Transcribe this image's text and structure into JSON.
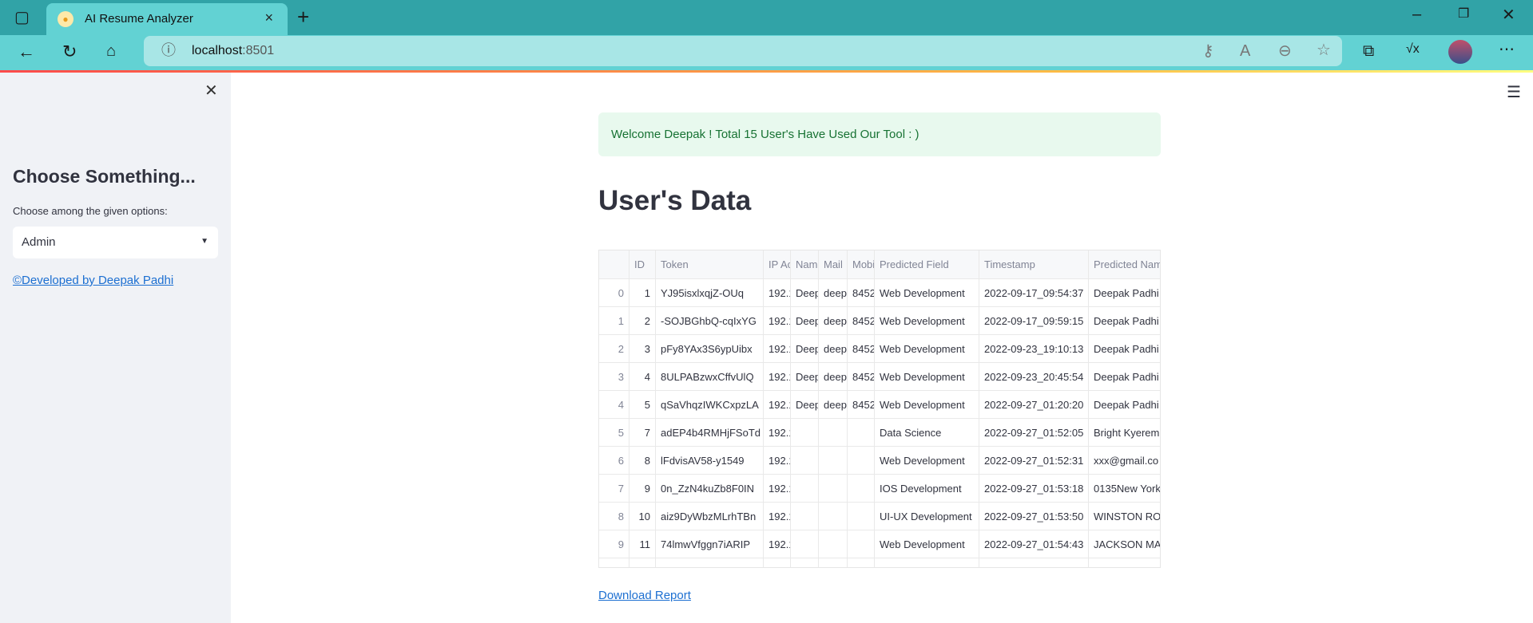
{
  "browser": {
    "tab_title": "AI Resume Analyzer",
    "url_host": "localhost",
    "url_port": ":8501"
  },
  "sidebar": {
    "heading": "Choose Something...",
    "select_label": "Choose among the given options:",
    "select_value": "Admin",
    "credit_link": "©Developed by Deepak Padhi"
  },
  "main": {
    "welcome": "Welcome Deepak ! Total 15 User's Have Used Our Tool : )",
    "title": "User's Data",
    "download_link": "Download Report",
    "table": {
      "columns": [
        "",
        "ID",
        "Token",
        "IP Ac",
        "Nam",
        "Mail",
        "Mobi",
        "Predicted Field",
        "Timestamp",
        "Predicted Nam"
      ],
      "rows": [
        [
          "0",
          "1",
          "YJ95isxlxqjZ-OUq",
          "192.1",
          "Deep",
          "deep",
          "8452",
          "Web Development",
          "2022-09-17_09:54:37",
          "Deepak Padhi"
        ],
        [
          "1",
          "2",
          "-SOJBGhbQ-cqIxYG",
          "192.1",
          "Deep",
          "deep",
          "8452",
          "Web Development",
          "2022-09-17_09:59:15",
          "Deepak Padhi"
        ],
        [
          "2",
          "3",
          "pFy8YAx3S6ypUibx",
          "192.1",
          "Deep",
          "deep",
          "8452",
          "Web Development",
          "2022-09-23_19:10:13",
          "Deepak Padhi"
        ],
        [
          "3",
          "4",
          "8ULPABzwxCffvUlQ",
          "192.1",
          "Deep",
          "deep",
          "8452",
          "Web Development",
          "2022-09-23_20:45:54",
          "Deepak Padhi"
        ],
        [
          "4",
          "5",
          "qSaVhqzIWKCxpzLA",
          "192.1",
          "Deep",
          "deep",
          "8452",
          "Web Development",
          "2022-09-27_01:20:20",
          "Deepak Padhi"
        ],
        [
          "5",
          "7",
          "adEP4b4RMHjFSoTd",
          "192.1",
          "",
          "",
          "",
          "Data Science",
          "2022-09-27_01:52:05",
          "Bright Kyerem"
        ],
        [
          "6",
          "8",
          "lFdvisAV58-y1549",
          "192.1",
          "",
          "",
          "",
          "Web Development",
          "2022-09-27_01:52:31",
          "xxx@gmail.co"
        ],
        [
          "7",
          "9",
          "0n_ZzN4kuZb8F0IN",
          "192.1",
          "",
          "",
          "",
          "IOS Development",
          "2022-09-27_01:53:18",
          "0135New York"
        ],
        [
          "8",
          "10",
          "aiz9DyWbzMLrhTBn",
          "192.1",
          "",
          "",
          "",
          "UI-UX Development",
          "2022-09-27_01:53:50",
          "WINSTON ROS"
        ],
        [
          "9",
          "11",
          "74lmwVfggn7iARIP",
          "192.1",
          "",
          "",
          "",
          "Web Development",
          "2022-09-27_01:54:43",
          "JACKSON MAC"
        ],
        [
          "",
          "",
          "",
          "",
          "",
          "",
          "",
          "",
          "",
          ""
        ]
      ]
    }
  }
}
